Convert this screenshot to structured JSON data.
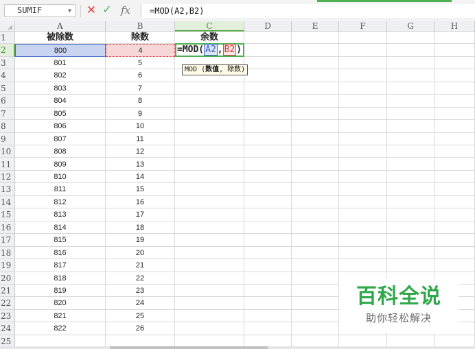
{
  "formula_bar": {
    "name_box": "SUMIF",
    "cancel_icon": "✕",
    "enter_icon": "✓",
    "fx_label": "fx",
    "formula": "=MOD(A2,B2)"
  },
  "columns": [
    "A",
    "B",
    "C",
    "D",
    "E",
    "F",
    "G",
    "H"
  ],
  "active_column": "C",
  "active_row": 2,
  "rows": [
    1,
    2,
    3,
    4,
    5,
    6,
    7,
    8,
    9,
    10,
    11,
    12,
    13,
    14,
    15,
    16,
    17,
    18,
    19,
    20,
    21,
    22,
    23,
    24,
    25
  ],
  "headers": {
    "a": "被除数",
    "b": "除数",
    "c": "余数"
  },
  "dividends": [
    "800",
    "801",
    "802",
    "803",
    "804",
    "805",
    "806",
    "807",
    "808",
    "809",
    "810",
    "811",
    "812",
    "813",
    "814",
    "815",
    "816",
    "817",
    "818",
    "819",
    "820",
    "821",
    "822"
  ],
  "divisors": [
    "4",
    "5",
    "6",
    "7",
    "8",
    "9",
    "10",
    "11",
    "12",
    "13",
    "14",
    "15",
    "16",
    "17",
    "18",
    "19",
    "20",
    "21",
    "22",
    "23",
    "24",
    "25",
    "26"
  ],
  "editing_cell": {
    "prefix": "=MOD(",
    "ref_a": "A2",
    "comma": ",",
    "ref_b": "B2",
    "suffix": ")"
  },
  "tooltip": {
    "fn": "MOD",
    "open": " (",
    "arg1": "数值",
    "sep": ", ",
    "arg2": "除数",
    "close": ")"
  },
  "watermark": {
    "title": "百科全说",
    "subtitle": "助你轻松解决"
  },
  "colors": {
    "accent_green": "#4caf50",
    "ref_a_blue": "#3a62c6",
    "ref_b_red": "#d24b4b",
    "watermark_green": "#2fa84a"
  }
}
